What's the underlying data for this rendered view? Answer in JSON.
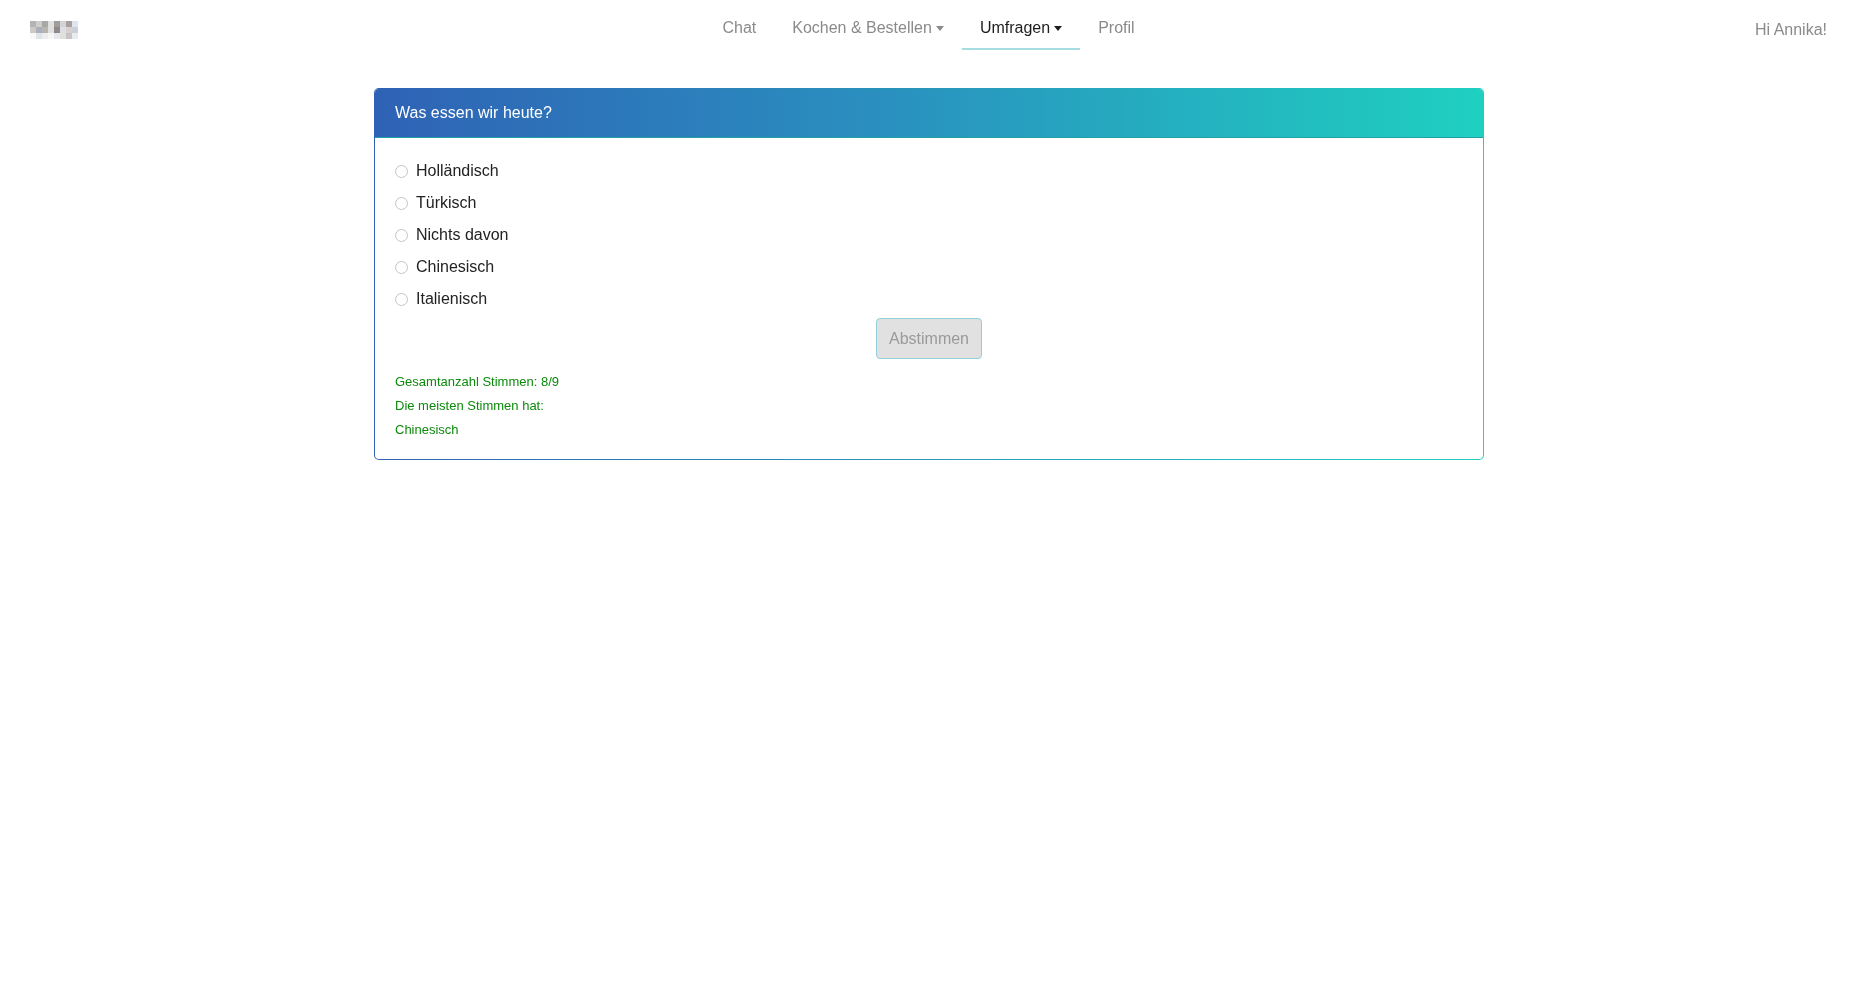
{
  "nav": {
    "items": [
      {
        "label": "Chat",
        "selected": false,
        "dropdown": false
      },
      {
        "label": "Kochen & Bestellen",
        "selected": false,
        "dropdown": true
      },
      {
        "label": "Umfragen",
        "selected": true,
        "dropdown": true
      },
      {
        "label": "Profil",
        "selected": false,
        "dropdown": false
      }
    ],
    "greeting": "Hi Annika!"
  },
  "poll": {
    "title": "Was essen wir heute?",
    "options": [
      {
        "label": "Holländisch",
        "selected": false
      },
      {
        "label": "Türkisch",
        "selected": false
      },
      {
        "label": "Nichts davon",
        "selected": false
      },
      {
        "label": "Chinesisch",
        "selected": false
      },
      {
        "label": "Italienisch",
        "selected": false
      }
    ],
    "submit": {
      "label": "Abstimmen",
      "disabled": true
    },
    "results": [
      "Gesamtanzahl Stimmen: 8/9",
      "Die meisten Stimmen hat:",
      "Chinesisch"
    ]
  }
}
